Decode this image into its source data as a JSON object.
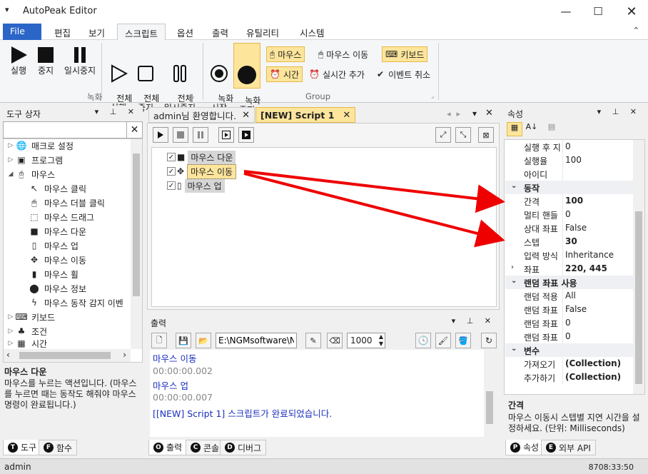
{
  "app": {
    "title": "AutoPeak Editor"
  },
  "menu_tabs": [
    "File",
    "편집",
    "보기",
    "스크립트",
    "옵션",
    "출력",
    "유틸리티",
    "시스템"
  ],
  "ribbon": {
    "run": "실행",
    "stop": "중지",
    "pause": "일시중지",
    "all_run": "전체\n실행",
    "all_stop": "전체\n중지",
    "all_pause": "전체\n일시중지",
    "rec_start": "녹화\n시작",
    "rec_stop": "녹화\n중지",
    "group_record": "녹화",
    "group_group": "Group",
    "mouse": "마우스",
    "mouse_move": "마우스 이동",
    "keyboard": "키보드",
    "time": "시간",
    "realtime_add": "실시간 추가",
    "event_cancel": "이벤트 취소"
  },
  "toolbox": {
    "title": "도구 상자",
    "items": [
      {
        "label": "매크로 설정",
        "icon": "globe-icon"
      },
      {
        "label": "프로그램",
        "icon": "program-icon"
      },
      {
        "label": "마우스",
        "icon": "mouse-icon"
      },
      {
        "label": "마우스 클릭",
        "icon": "mouse-click-icon"
      },
      {
        "label": "마우스 더블 클릭",
        "icon": "mouse-double-click-icon"
      },
      {
        "label": "마우스 드래그",
        "icon": "mouse-drag-icon"
      },
      {
        "label": "마우스 다운",
        "icon": "mouse-down-icon"
      },
      {
        "label": "마우스 업",
        "icon": "mouse-up-icon"
      },
      {
        "label": "마우스 이동",
        "icon": "move-icon"
      },
      {
        "label": "마우스 휠",
        "icon": "mouse-wheel-icon"
      },
      {
        "label": "마우스 정보",
        "icon": "mouse-info-icon"
      },
      {
        "label": "마우스 동작 감지 이벤",
        "icon": "lightning-icon"
      },
      {
        "label": "키보드",
        "icon": "keyboard-icon"
      },
      {
        "label": "조건",
        "icon": "condition-icon"
      },
      {
        "label": "시간",
        "icon": "calendar-icon"
      }
    ],
    "desc_title": "마우스 다운",
    "desc_body": "마우스를 누르는 액션입니다. (마우스를 누르면 때는 동작도 해줘야 마우스 명령이 완료됩니다.)",
    "tabs": [
      "도구",
      "함수"
    ]
  },
  "documents": {
    "tabs": [
      "admin님 환영합니다.",
      "[NEW] Script 1"
    ],
    "steps": [
      "마우스 다운",
      "마우스 이동",
      "마우스 업"
    ]
  },
  "output": {
    "title": "출력",
    "path": "E:\\NGMsoftware\\NG",
    "interval": "1000",
    "lines": [
      {
        "text": "마우스 이동",
        "style": "cmd"
      },
      {
        "text": "00:00:00.002",
        "style": "time"
      },
      {
        "text": "마우스 업",
        "style": "cmd"
      },
      {
        "text": "00:00:00.007",
        "style": "time"
      },
      {
        "text": "[[NEW] Script 1] 스크립트가 완료되었습니다.",
        "style": "done"
      }
    ],
    "tabs": [
      "출력",
      "콘솔",
      "디버그"
    ]
  },
  "properties": {
    "title": "속성",
    "rows": [
      {
        "type": "row",
        "k": "실행 후 지",
        "v": "0"
      },
      {
        "type": "row",
        "k": "실행율",
        "v": "100"
      },
      {
        "type": "row",
        "k": "아이디",
        "v": ""
      },
      {
        "type": "cat",
        "k": "동작"
      },
      {
        "type": "row",
        "k": "간격",
        "v": "100",
        "bold": true
      },
      {
        "type": "row",
        "k": "멀티 핸들",
        "v": "0"
      },
      {
        "type": "row",
        "k": "상대 좌표",
        "v": "False"
      },
      {
        "type": "row",
        "k": "스텝",
        "v": "30",
        "bold": true
      },
      {
        "type": "row",
        "k": "입력 방식",
        "v": "Inheritance"
      },
      {
        "type": "row",
        "k": "좌표",
        "v": "220, 445",
        "bold": true,
        "expand": true
      },
      {
        "type": "cat",
        "k": "랜덤 좌표 사용"
      },
      {
        "type": "row",
        "k": "랜덤 적용",
        "v": "All"
      },
      {
        "type": "row",
        "k": "랜덤 좌표",
        "v": "False"
      },
      {
        "type": "row",
        "k": "랜덤 좌표",
        "v": "0"
      },
      {
        "type": "row",
        "k": "랜덤 좌표",
        "v": "0"
      },
      {
        "type": "cat",
        "k": "변수"
      },
      {
        "type": "row",
        "k": "가져오기",
        "v": "(Collection)",
        "bold": true
      },
      {
        "type": "row",
        "k": "추가하기",
        "v": "(Collection)",
        "bold": true
      }
    ],
    "desc_title": "간격",
    "desc_body": "마우스 이동시 스텝별 지연 시간을 설정하세요. (단위: Milliseconds)",
    "tabs": [
      "속성",
      "외부 API"
    ]
  },
  "status": {
    "user": "admin",
    "time": "8708:33:50"
  }
}
